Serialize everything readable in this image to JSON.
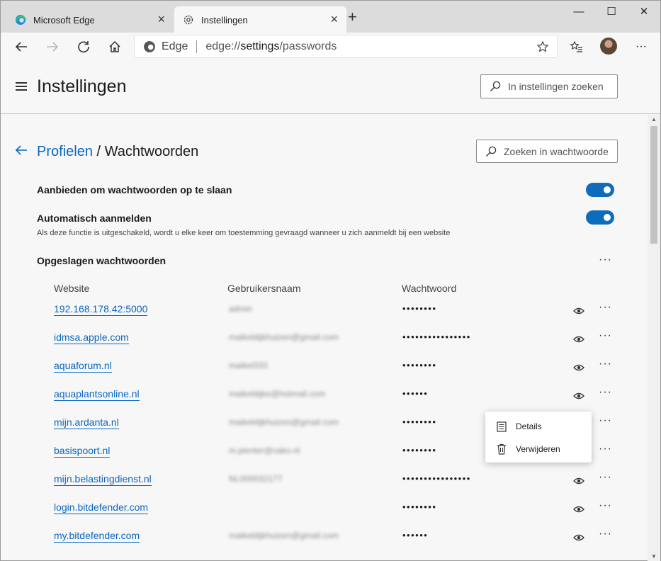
{
  "tabs": [
    {
      "label": "Microsoft Edge",
      "active": false
    },
    {
      "label": "Instellingen",
      "active": true
    }
  ],
  "window_controls": {
    "minimize": "—",
    "maximize": "☐",
    "close": "✕"
  },
  "address": {
    "brand": "Edge",
    "url_prefix": "edge://",
    "url_bold": "settings",
    "url_suffix": "/passwords"
  },
  "header": {
    "title": "Instellingen",
    "search_placeholder": "In instellingen zoeken"
  },
  "breadcrumb": {
    "parent": "Profielen",
    "separator": " / ",
    "current": "Wachtwoorden"
  },
  "password_search_placeholder": "Zoeken in wachtwoorde",
  "settings": {
    "offer_save_label": "Aanbieden om wachtwoorden op te slaan",
    "offer_save_on": true,
    "auto_signin_label": "Automatisch aanmelden",
    "auto_signin_on": true,
    "auto_signin_desc": "Als deze functie is uitgeschakeld, wordt u elke keer om toestemming gevraagd wanneer u zich aanmeldt bij een website"
  },
  "saved_passwords": {
    "title": "Opgeslagen wachtwoorden",
    "columns": {
      "website": "Website",
      "username": "Gebruikersnaam",
      "password": "Wachtwoord"
    },
    "rows": [
      {
        "site": "192.168.178.42:5000",
        "user": "admin",
        "pass": "••••••••"
      },
      {
        "site": "idmsa.apple.com",
        "user": "maikeldijkhuizen@gmail.com",
        "pass": "••••••••••••••••"
      },
      {
        "site": "aquaforum.nl",
        "user": "maikel333",
        "pass": "••••••••"
      },
      {
        "site": "aquaplantsonline.nl",
        "user": "maikeldijke@hotmail.com",
        "pass": "••••••"
      },
      {
        "site": "mijn.ardanta.nl",
        "user": "maikeldijkhuizen@gmail.com",
        "pass": "••••••••"
      },
      {
        "site": "basispoort.nl",
        "user": "m.pienter@vako.nl",
        "pass": "••••••••"
      },
      {
        "site": "mijn.belastingdienst.nl",
        "user": "NL000032177",
        "pass": "••••••••••••••••"
      },
      {
        "site": "login.bitdefender.com",
        "user": "",
        "pass": "••••••••"
      },
      {
        "site": "my.bitdefender.com",
        "user": "maikeldijkhuizen@gmail.com",
        "pass": "••••••"
      }
    ]
  },
  "context_menu": {
    "details": "Details",
    "delete": "Verwijderen"
  },
  "more_glyph": "···",
  "colors": {
    "accent": "#0f6cbd",
    "link": "#0a66c2"
  }
}
